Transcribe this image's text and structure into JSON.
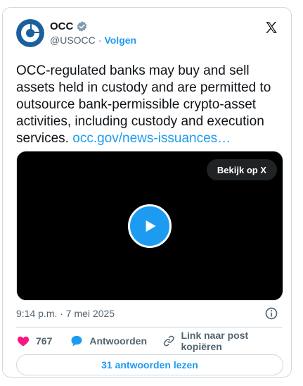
{
  "author": {
    "name": "OCC",
    "handle": "@USOCC",
    "separator": "·",
    "follow_label": "Volgen",
    "avatar": "occ-logo",
    "verified_badge": "gray-check-badge-icon"
  },
  "header": {
    "platform_icon": "x-logo-icon"
  },
  "tweet": {
    "text": "OCC-regulated banks may buy and sell assets held in custody and are permitted to outsource bank-permissible crypto-asset activities, including custody and execution services.",
    "link": "occ.gov/news-issuances…"
  },
  "video": {
    "watch_label": "Bekijk op X",
    "play_icon": "play-icon"
  },
  "timestamp": "9:14 p.m. · 7 mei 2025",
  "actions": {
    "like_count": "767",
    "reply_label": "Antwoorden",
    "copy_link_label": "Link naar post kopiëren"
  },
  "read_replies_label": "31 antwoorden lezen",
  "colors": {
    "accent": "#1d9bf0",
    "like": "#f91880",
    "secondary_text": "#536471",
    "border": "#cfd9de"
  }
}
